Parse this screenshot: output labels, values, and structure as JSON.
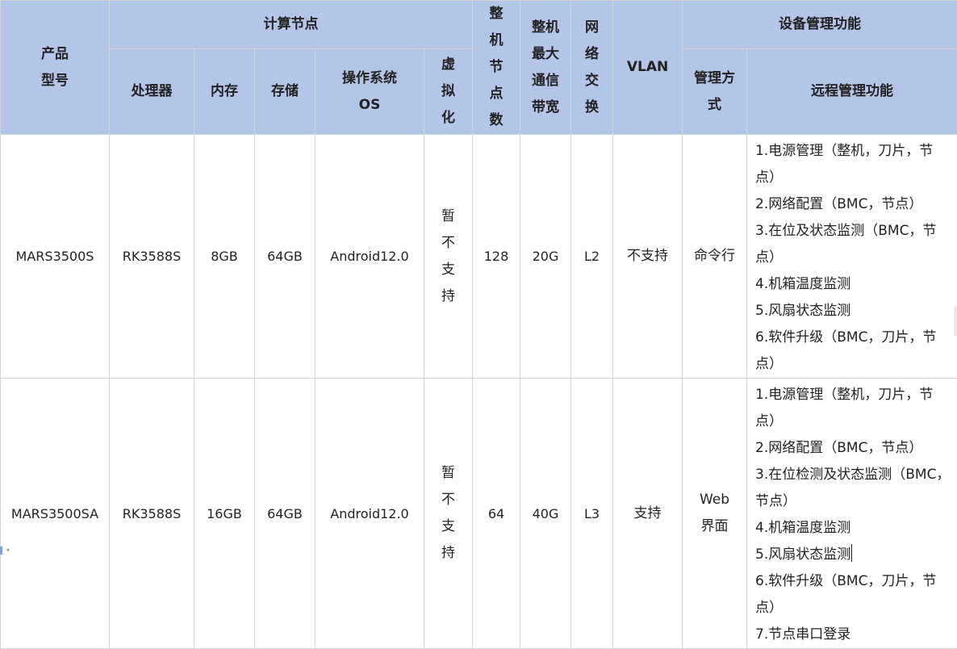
{
  "header": {
    "product_model": [
      "产品",
      "型号"
    ],
    "compute_node": "计算节点",
    "processor": "处理器",
    "memory": "内存",
    "storage": "存储",
    "os": [
      "操作系统",
      "OS"
    ],
    "virtualization": [
      "虚",
      "拟",
      "化"
    ],
    "node_count": [
      "整",
      "机",
      "节",
      "点",
      "数"
    ],
    "bandwidth": [
      "整机",
      "最大",
      "通信",
      "带宽"
    ],
    "network_switch": [
      "网",
      "络",
      "交",
      "换"
    ],
    "vlan": "VLAN",
    "device_mgmt": "设备管理功能",
    "mgmt_mode": [
      "管理方",
      "式"
    ],
    "remote_mgmt": "远程管理功能"
  },
  "rows": [
    {
      "model": "MARS3500S",
      "processor": "RK3588S",
      "memory": "8GB",
      "storage": "64GB",
      "os": "Android12.0",
      "virtualization": [
        "暂",
        "不",
        "支",
        "持"
      ],
      "node_count": "128",
      "bandwidth": "20G",
      "network_switch": "L2",
      "vlan": "不支持",
      "mgmt_mode": [
        "命令行"
      ],
      "functions": [
        "1.电源管理（整机，刀片，节点）",
        "2.网络配置（BMC，节点）",
        "3.在位及状态监测（BMC，节点）",
        "4.机箱温度监测",
        "5.风扇状态监测",
        "6.软件升级（BMC，刀片，节点）"
      ]
    },
    {
      "model": "MARS3500SA",
      "processor": "RK3588S",
      "memory": "16GB",
      "storage": "64GB",
      "os": "Android12.0",
      "virtualization": [
        "暂",
        "不",
        "支",
        "持"
      ],
      "node_count": "64",
      "bandwidth": "40G",
      "network_switch": "L3",
      "vlan": "支持",
      "mgmt_mode": [
        "Web",
        "界面"
      ],
      "functions": [
        "1.电源管理（整机，刀片，节点）",
        "2.网络配置（BMC，节点）",
        "3.在位检测及状态监测（BMC，节点）",
        "4.机箱温度监测",
        "5.风扇状态监测",
        "6.软件升级（BMC，刀片，节点）",
        "7.节点串口登录"
      ]
    }
  ],
  "colors": {
    "header_bg": "#b4c6e7",
    "border": "#d4d4d4",
    "text": "#222222"
  }
}
